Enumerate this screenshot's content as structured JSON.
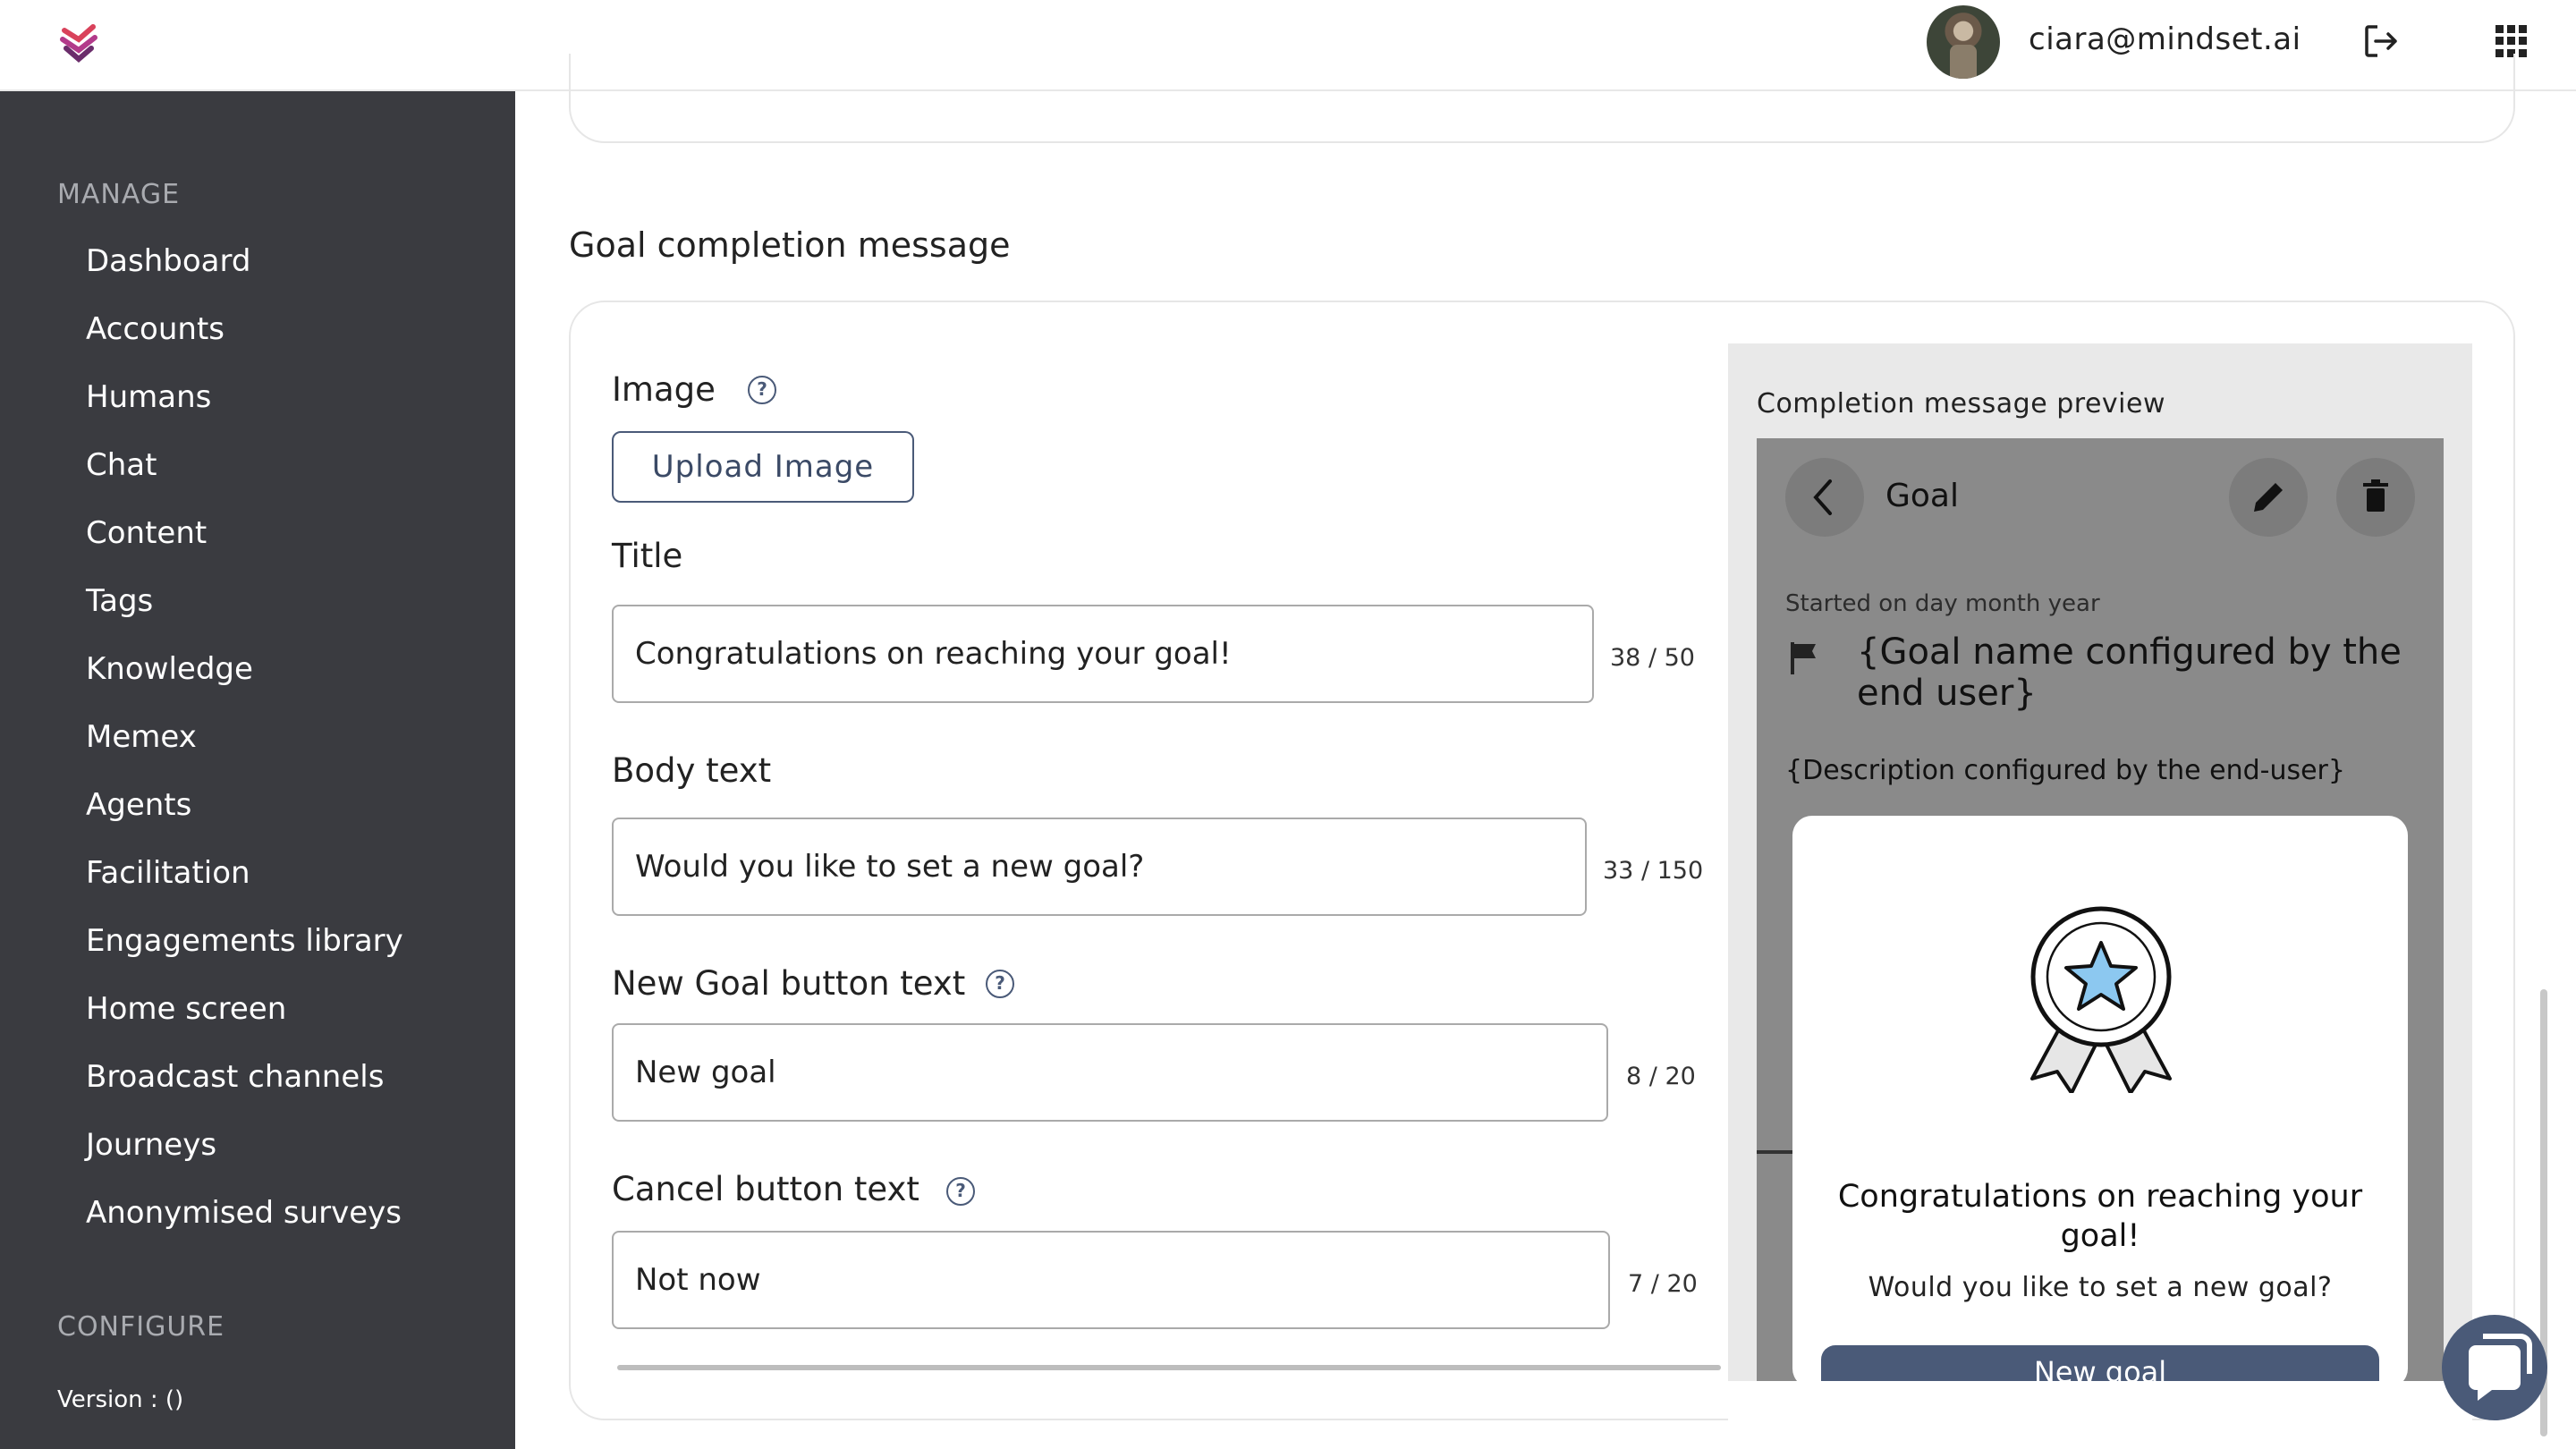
{
  "header": {
    "user_email": "ciara@mindset.ai"
  },
  "sidebar": {
    "manage_heading": "MANAGE",
    "items": [
      {
        "label": "Dashboard"
      },
      {
        "label": "Accounts"
      },
      {
        "label": "Humans"
      },
      {
        "label": "Chat"
      },
      {
        "label": "Content"
      },
      {
        "label": "Tags"
      },
      {
        "label": "Knowledge"
      },
      {
        "label": "Memex"
      },
      {
        "label": "Agents"
      },
      {
        "label": "Facilitation"
      },
      {
        "label": "Engagements library"
      },
      {
        "label": "Home screen"
      },
      {
        "label": "Broadcast channels"
      },
      {
        "label": "Journeys"
      },
      {
        "label": "Anonymised surveys"
      }
    ],
    "configure_heading": "CONFIGURE",
    "version_label": "Version :  ()"
  },
  "section": {
    "title": "Goal completion message"
  },
  "form": {
    "image_label": "Image",
    "upload_button": "Upload Image",
    "title_label": "Title",
    "title_value": "Congratulations on reaching your goal!",
    "title_counter": "38 / 50",
    "body_label": "Body text",
    "body_value": "Would you like to set a new goal?",
    "body_counter": "33 / 150",
    "new_goal_label": "New Goal button text",
    "new_goal_value": "New goal",
    "new_goal_counter": "8 / 20",
    "cancel_label": "Cancel button text",
    "cancel_value": "Not now",
    "cancel_counter": "7 / 20"
  },
  "preview": {
    "heading": "Completion message preview",
    "screen_title": "Goal",
    "started_text": "Started on day month year",
    "goal_name": "{Goal name configured by the end user}",
    "description": "{Description configured by the end-user}",
    "modal_title": "Congratulations on reaching your goal!",
    "modal_body": "Would you like to set a new goal?",
    "modal_button": "New goal"
  },
  "colors": {
    "sidebar_bg": "#3a3b40",
    "accent": "#4a5a78",
    "logo_purple": "#6b2d6b",
    "logo_red": "#d9425b"
  }
}
